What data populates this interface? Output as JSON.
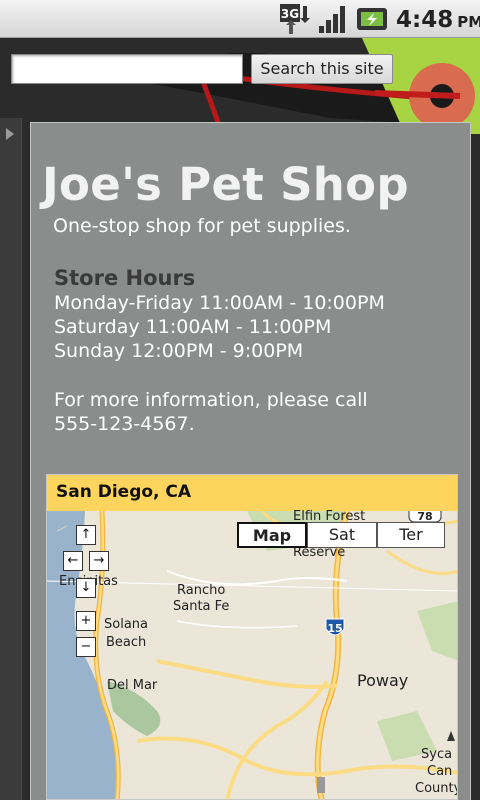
{
  "status_bar": {
    "network": "3G",
    "time": "4:48",
    "ampm": "PM"
  },
  "search": {
    "input_value": "",
    "button_label": "Search this site"
  },
  "page": {
    "title": "Joe's Pet Shop",
    "subtitle": "One-stop shop for pet supplies.",
    "hours_heading": "Store Hours",
    "hours": [
      "Monday-Friday 11:00AM - 10:00PM",
      "Saturday 11:00AM - 11:00PM",
      "Sunday 12:00PM - 9:00PM"
    ],
    "info_line1": "For more information, please call",
    "info_line2": "555-123-4567."
  },
  "map": {
    "header": "San Diego, CA",
    "types": [
      "Map",
      "Sat",
      "Ter"
    ],
    "selected_type": "Map",
    "labels": {
      "elfin_forest": "Elfin Forest",
      "reserve": "Reserve",
      "encinitas": "Encinitas",
      "rancho": "Rancho",
      "santa_fe": "Santa Fe",
      "solana": "Solana",
      "beach": "Beach",
      "del_mar": "Del Mar",
      "poway": "Poway",
      "sycamore": "Syca",
      "can": "Can",
      "county": "County"
    },
    "shields": {
      "i15": "15",
      "sr78": "78"
    },
    "nav": {
      "up": "↑",
      "left": "←",
      "right": "→",
      "down": "↓",
      "zoom_in": "+",
      "zoom_out": "−"
    }
  },
  "colors": {
    "panel": "#8b8c8c",
    "map_header": "#fdd55e",
    "ocean": "#99b3cc",
    "freeway": "#f7c24a"
  }
}
